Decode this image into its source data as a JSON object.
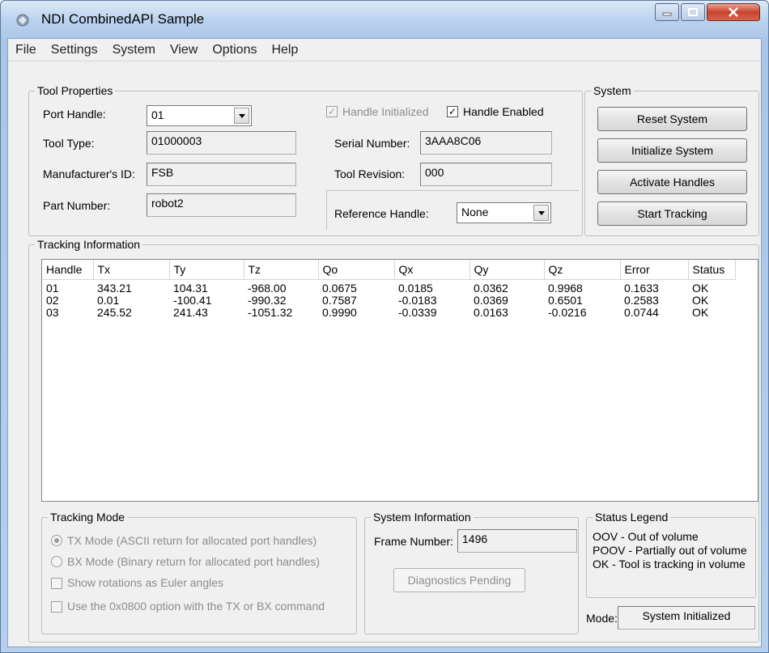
{
  "window": {
    "title": "NDI CombinedAPI Sample"
  },
  "menu": [
    "File",
    "Settings",
    "System",
    "View",
    "Options",
    "Help"
  ],
  "tool_properties": {
    "legend": "Tool Properties",
    "port_handle_label": "Port Handle:",
    "port_handle_value": "01",
    "tool_type_label": "Tool Type:",
    "tool_type_value": "01000003",
    "manufacturer_label": "Manufacturer's ID:",
    "manufacturer_value": "FSB",
    "part_number_label": "Part Number:",
    "part_number_value": "robot2",
    "handle_initialized_label": "Handle Initialized",
    "handle_enabled_label": "Handle Enabled",
    "serial_label": "Serial Number:",
    "serial_value": "3AAA8C06",
    "revision_label": "Tool Revision:",
    "revision_value": "000",
    "reference_label": "Reference Handle:",
    "reference_value": "None"
  },
  "system": {
    "legend": "System",
    "reset": "Reset System",
    "initialize": "Initialize System",
    "activate": "Activate Handles",
    "start": "Start Tracking"
  },
  "tracking": {
    "legend": "Tracking Information",
    "columns": [
      "Handle",
      "Tx",
      "Ty",
      "Tz",
      "Qo",
      "Qx",
      "Qy",
      "Qz",
      "Error",
      "Status"
    ],
    "rows": [
      [
        "01",
        "343.21",
        "104.31",
        "-968.00",
        "0.0675",
        "0.0185",
        "0.0362",
        "0.9968",
        "0.1633",
        "OK"
      ],
      [
        "02",
        "0.01",
        "-100.41",
        "-990.32",
        "0.7587",
        "-0.0183",
        "0.0369",
        "0.6501",
        "0.2583",
        "OK"
      ],
      [
        "03",
        "245.52",
        "241.43",
        "-1051.32",
        "0.9990",
        "-0.0339",
        "0.0163",
        "-0.0216",
        "0.0744",
        "OK"
      ]
    ]
  },
  "tracking_mode": {
    "legend": "Tracking Mode",
    "tx_mode": "TX Mode (ASCII return for allocated port handles)",
    "bx_mode": "BX Mode (Binary return for allocated port handles)",
    "euler": "Show rotations as Euler angles",
    "option_0800": "Use the 0x0800 option with the TX or BX command"
  },
  "system_info": {
    "legend": "System Information",
    "frame_label": "Frame Number:",
    "frame_value": "1496",
    "diagnostics": "Diagnostics Pending"
  },
  "status_legend": {
    "legend": "Status Legend",
    "lines": [
      "OOV - Out of volume",
      "POOV - Partially out of volume",
      "OK - Tool is tracking in volume"
    ],
    "mode_label": "Mode:",
    "mode_value": "System Initialized"
  }
}
